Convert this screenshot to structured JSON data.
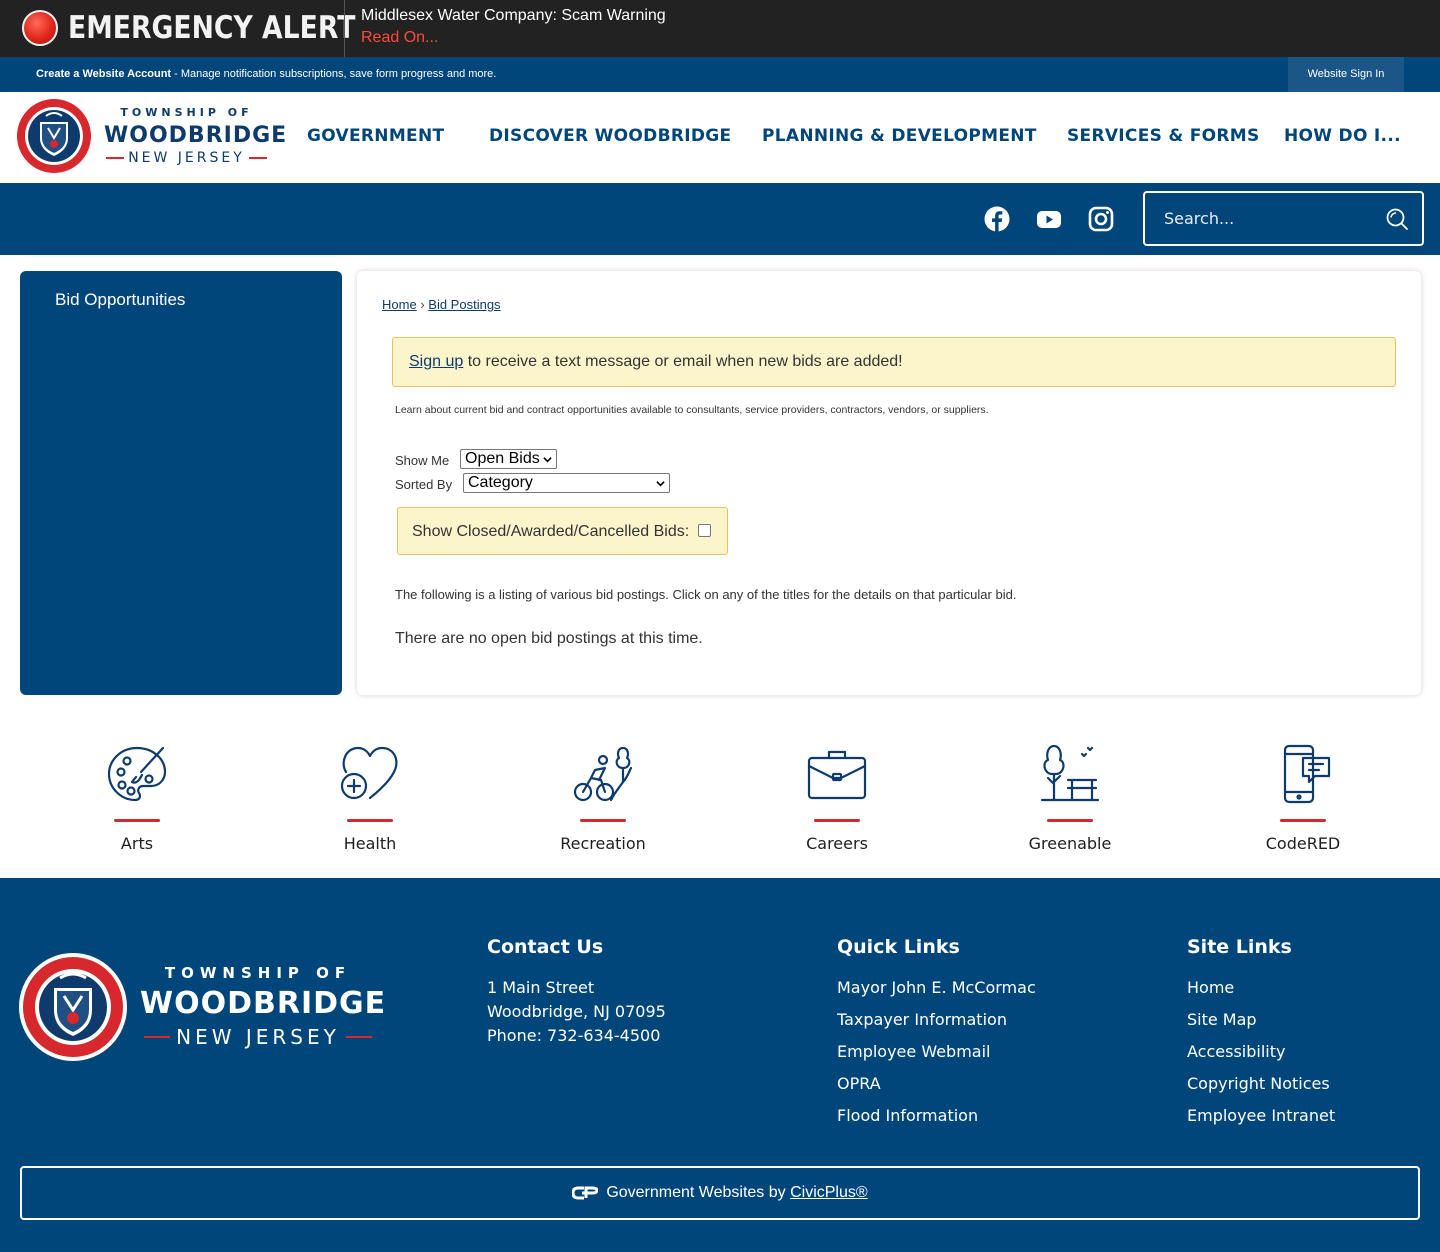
{
  "alert": {
    "title": "EMERGENCY ALERT",
    "message": "Middlesex Water Company: Scam Warning",
    "read_on": "Read On..."
  },
  "account_bar": {
    "create_label": "Create a Website Account",
    "create_desc": " - Manage notification subscriptions, save form progress and more.",
    "sign_in": "Website Sign In"
  },
  "logo": {
    "township": "TOWNSHIP OF",
    "name": "WOODBRIDGE",
    "state": "NEW JERSEY"
  },
  "nav": {
    "items": [
      {
        "label": "GOVERNMENT"
      },
      {
        "label": "DISCOVER WOODBRIDGE"
      },
      {
        "label": "PLANNING & DEVELOPMENT"
      },
      {
        "label": "SERVICES & FORMS"
      },
      {
        "label": "HOW DO I..."
      }
    ]
  },
  "social": {
    "icons": [
      "facebook-icon",
      "youtube-icon",
      "instagram-icon"
    ]
  },
  "search": {
    "placeholder": "Search..."
  },
  "sidebar": {
    "items": [
      {
        "label": "Bid Opportunities"
      }
    ]
  },
  "breadcrumb": {
    "home": "Home",
    "separator": "›",
    "current": "Bid Postings"
  },
  "signup": {
    "link": "Sign up",
    "text": " to receive a text message or email when new bids are added!"
  },
  "intro": "Learn about current bid and contract opportunities available to consultants, service providers, contractors, vendors, or suppliers.",
  "filters": {
    "show_me_label": "Show Me",
    "show_me_value": "Open Bids",
    "sorted_by_label": "Sorted By",
    "sorted_by_value": "Category",
    "closed_label": "Show Closed/Awarded/Cancelled Bids:",
    "closed_checked": false
  },
  "listing_text": "The following is a listing of various bid postings. Click on any of the titles for the details on that particular bid.",
  "no_bids_text": "There are no open bid postings at this time.",
  "quick_links": [
    {
      "label": "Arts",
      "icon": "palette-icon"
    },
    {
      "label": "Health",
      "icon": "heart-health-icon"
    },
    {
      "label": "Recreation",
      "icon": "cyclist-icon"
    },
    {
      "label": "Careers",
      "icon": "briefcase-icon"
    },
    {
      "label": "Greenable",
      "icon": "park-bench-icon"
    },
    {
      "label": "CodeRED",
      "icon": "phone-message-icon"
    }
  ],
  "footer": {
    "logo": {
      "township": "TOWNSHIP OF",
      "name": "WOODBRIDGE",
      "state": "NEW JERSEY"
    },
    "contact": {
      "heading": "Contact Us",
      "address1": "1 Main Street",
      "address2": "Woodbridge, NJ 07095",
      "phone": "Phone: 732-634-4500"
    },
    "quick_links": {
      "heading": "Quick Links",
      "items": [
        "Mayor John E. McCormac",
        "Taxpayer Information",
        "Employee Webmail",
        "OPRA",
        "Flood Information"
      ]
    },
    "site_links": {
      "heading": "Site Links",
      "items": [
        "Home",
        "Site Map",
        "Accessibility",
        "Copyright Notices",
        "Employee Intranet"
      ]
    },
    "civic": {
      "prefix": "Government Websites by ",
      "link": "CivicPlus®"
    }
  },
  "colors": {
    "brand_blue": "#01467a",
    "alert_red": "#e0261b",
    "accent_red": "#d6282d",
    "notice_yellow": "#fcf5cc"
  }
}
